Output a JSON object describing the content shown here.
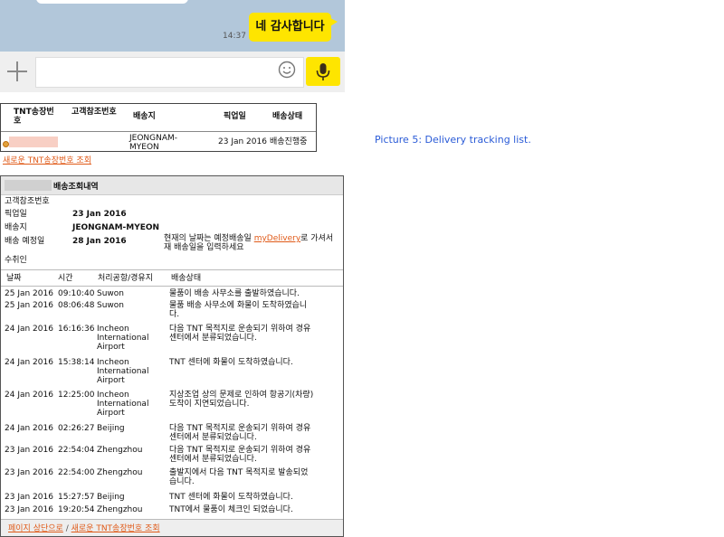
{
  "chat": {
    "time": "14:37",
    "message": "네 감사합니다"
  },
  "tracking_list": {
    "headers": [
      "TNT송장번호",
      "고객참조번호",
      "배송지",
      "픽업일",
      "배송상태"
    ],
    "row": {
      "destination": "JEONGNAM-MYEON",
      "pickup_date": "23 Jan 2016",
      "status": "배송진행중"
    },
    "new_search_link": "새로운 TNT송장번호 조회"
  },
  "caption": "Picture 5: Delivery tracking list.",
  "detail": {
    "title": "배송조회내역",
    "customer_ref_label": "고객참조번호",
    "pickup_label": "픽업일",
    "pickup_value": "23 Jan 2016",
    "destination_label": "배송지",
    "destination_value": "JEONGNAM-MYEON",
    "expected_label": "배송 예정일",
    "expected_value": "28 Jan 2016",
    "note_prefix": "현재의 날짜는 예정배송일",
    "note_link": "myDelivery",
    "note_suffix": "로 가셔서",
    "note_line2": "재 배송일을 입력하세요",
    "recipient_label": "수취인",
    "columns": [
      "날짜",
      "시간",
      "처리공항/경유지",
      "배송상태"
    ],
    "events": [
      {
        "date": "25 Jan 2016",
        "time": "09:10:40",
        "loc": [
          "Suwon"
        ],
        "status": [
          "물품이 배송 사무소를 출발하였습니다."
        ]
      },
      {
        "date": "25 Jan 2016",
        "time": "08:06:48",
        "loc": [
          "Suwon"
        ],
        "status": [
          "물품 배송 사무소에 화물이 도착하였습니",
          "다."
        ]
      },
      {
        "date": "24 Jan 2016",
        "time": "16:16:36",
        "loc": [
          "Incheon",
          "International",
          "Airport"
        ],
        "status": [
          "다음 TNT 목적지로 운송되기 위하여 경유",
          "센터에서 분류되었습니다."
        ]
      },
      {
        "date": "24 Jan 2016",
        "time": "15:38:14",
        "loc": [
          "Incheon",
          "International",
          "Airport"
        ],
        "status": [
          "TNT 센터에 화물이 도착하였습니다."
        ]
      },
      {
        "date": "24 Jan 2016",
        "time": "12:25:00",
        "loc": [
          "Incheon",
          "International",
          "Airport"
        ],
        "status": [
          "지상조업 상의 문제로 인하여 항공기(차량)",
          "도착이 지연되었습니다."
        ]
      },
      {
        "date": "24 Jan 2016",
        "time": "02:26:27",
        "loc": [
          "Beijing"
        ],
        "status": [
          "다음 TNT 목적지로 운송되기 위하여 경유",
          "센터에서 분류되었습니다."
        ]
      },
      {
        "date": "23 Jan 2016",
        "time": "22:54:04",
        "loc": [
          "Zhengzhou"
        ],
        "status": [
          "다음 TNT 목적지로 운송되기 위하여 경유",
          "센터에서 분류되었습니다."
        ]
      },
      {
        "date": "23 Jan 2016",
        "time": "22:54:00",
        "loc": [
          "Zhengzhou"
        ],
        "status": [
          "출발지에서 다음 TNT 목적지로 발송되었",
          "습니다."
        ]
      },
      {
        "date": "23 Jan 2016",
        "time": "15:27:57",
        "loc": [
          "Beijing"
        ],
        "status": [
          "TNT 센터에 화물이 도착하였습니다."
        ]
      },
      {
        "date": "23 Jan 2016",
        "time": "19:20:54",
        "loc": [
          "Zhengzhou"
        ],
        "status": [
          "TNT에서 물품이 체크인 되었습니다."
        ]
      }
    ],
    "footer_top_link": "페이지 상단으로",
    "footer_sep": "/",
    "footer_new_link": "새로운 TNT송장번호 조회"
  }
}
